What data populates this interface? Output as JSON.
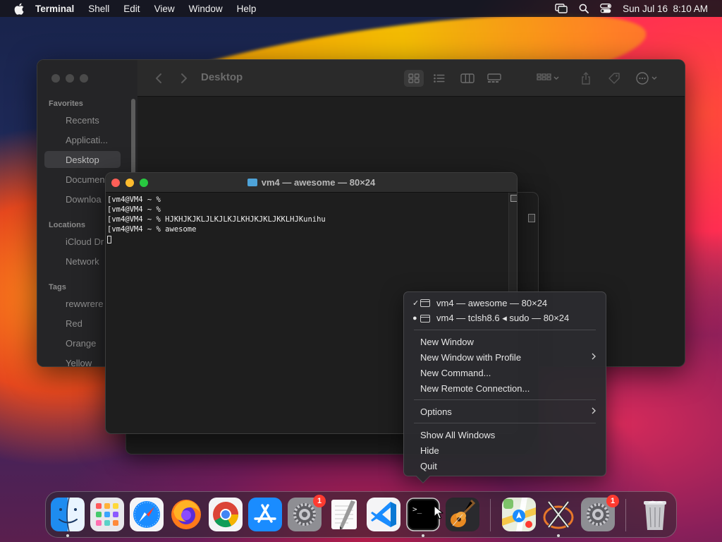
{
  "menubar": {
    "app_name": "Terminal",
    "items": [
      "Shell",
      "Edit",
      "View",
      "Window",
      "Help"
    ],
    "datetime": "Sun Jul 16  8:10 AM"
  },
  "finder": {
    "title": "Desktop",
    "sections": {
      "favorites": "Favorites",
      "locations": "Locations",
      "tags": "Tags"
    },
    "favorites": [
      "Recents",
      "Applicati...",
      "Desktop",
      "Documen",
      "Downloa"
    ],
    "locations": [
      "iCloud Dr",
      "Network"
    ],
    "tags": [
      "rewwrere",
      "Red",
      "Orange",
      "Yellow"
    ]
  },
  "terminal": {
    "title": "vm4 — awesome — 80×24",
    "lines": [
      "[vm4@VM4 ~ % ",
      "[vm4@VM4 ~ % ",
      "[vm4@VM4 ~ % HJKHJKJKLJLKJLKJLKHJKJKLJKKLHJKunihu",
      "[vm4@VM4 ~ % awesome"
    ]
  },
  "context_menu": {
    "windows": [
      {
        "label": "vm4 — awesome — 80×24",
        "marker": "✓"
      },
      {
        "label": "vm4 — tclsh8.6 ◂ sudo — 80×24",
        "marker": "●"
      }
    ],
    "group1": [
      "New Window",
      "New Window with Profile",
      "New Command...",
      "New Remote Connection..."
    ],
    "options": "Options",
    "group3": [
      "Show All Windows",
      "Hide",
      "Quit"
    ]
  },
  "dock": {
    "apps": [
      "finder",
      "launchpad",
      "safari",
      "firefox",
      "chrome",
      "app-store",
      "system-settings",
      "textedit",
      "vscode",
      "terminal",
      "garageband",
      "maps",
      "xquartz",
      "system-settings-2",
      "trash"
    ],
    "badges": {
      "system-settings": "1",
      "system-settings-2": "1"
    }
  },
  "colors": {
    "traffic_red": "#ff5f57",
    "traffic_yellow": "#febc2e",
    "traffic_green": "#28c840",
    "badge_red": "#ff3b30"
  }
}
